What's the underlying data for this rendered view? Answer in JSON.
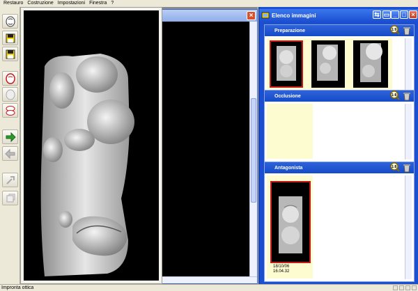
{
  "menu": [
    "Restauro",
    "Costruzione",
    "Impostazioni",
    "Finestra",
    "?"
  ],
  "toolbar": {
    "buttons": [
      "scan-tooth-icon",
      "save-disk-icon",
      "save-disk-alt-icon",
      "tooth-red-icon",
      "tooth-grey-icon",
      "teeth-occlusion-icon",
      "arrow-right-icon",
      "arrow-left-icon",
      "tool-grey-icon",
      "copy-grey-icon"
    ]
  },
  "document_window": {
    "close": "×"
  },
  "image_panel": {
    "title": "Elenco immagini",
    "window_buttons": [
      "⇆",
      "▭",
      "_",
      "□",
      "×"
    ],
    "sections": [
      {
        "name": "Preparazione",
        "zoom": "1:9"
      },
      {
        "name": "Occlusione",
        "zoom": "1:8"
      },
      {
        "name": "Antagonista",
        "zoom": "1:8"
      }
    ],
    "antagonista_thumb": {
      "date": "18/10/06",
      "time": "16.04.32"
    }
  },
  "status": {
    "text": "Impronta ottica"
  },
  "colors": {
    "titlebar": "#1b4fd1",
    "selection": "#c41a1a",
    "thumb_bg": "#fdfbd0"
  }
}
